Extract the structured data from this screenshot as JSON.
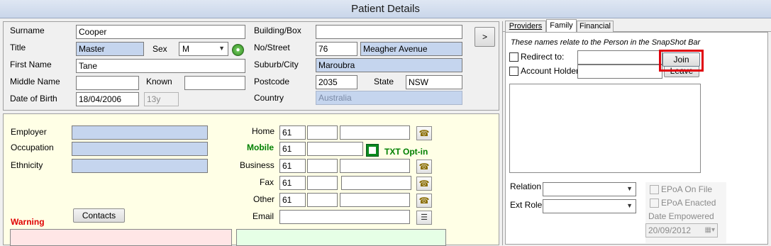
{
  "window": {
    "title": "Patient Details"
  },
  "top": {
    "surname": {
      "label": "Surname",
      "value": "Cooper"
    },
    "title": {
      "label": "Title",
      "value": "Master"
    },
    "sex": {
      "label": "Sex",
      "value": "M"
    },
    "first_name": {
      "label": "First Name",
      "value": "Tane"
    },
    "middle_name": {
      "label": "Middle Name",
      "value": ""
    },
    "known": {
      "label": "Known",
      "value": ""
    },
    "dob": {
      "label": "Date of Birth",
      "value": "18/04/2006",
      "age": "13y"
    },
    "building": {
      "label": "Building/Box",
      "value": ""
    },
    "street": {
      "label": "No/Street",
      "number": "76",
      "name": "Meagher Avenue"
    },
    "suburb": {
      "label": "Suburb/City",
      "value": "Maroubra"
    },
    "postcode": {
      "label": "Postcode",
      "value": "2035"
    },
    "state": {
      "label": "State",
      "value": "NSW"
    },
    "country": {
      "label": "Country",
      "value": "Australia"
    },
    "more_button": ">"
  },
  "lower": {
    "employer": {
      "label": "Employer",
      "value": ""
    },
    "occupation": {
      "label": "Occupation",
      "value": ""
    },
    "ethnicity": {
      "label": "Ethnicity",
      "value": ""
    },
    "warning": "Warning",
    "contacts_button": "Contacts",
    "phones": {
      "home": {
        "label": "Home",
        "code": "61"
      },
      "mobile": {
        "label": "Mobile",
        "code": "61"
      },
      "business": {
        "label": "Business",
        "code": "61"
      },
      "fax": {
        "label": "Fax",
        "code": "61"
      },
      "other": {
        "label": "Other",
        "code": "61"
      }
    },
    "txt_optin": "TXT Opt-in",
    "email": {
      "label": "Email",
      "value": ""
    }
  },
  "right": {
    "tabs": [
      "Providers",
      "Family",
      "Financial"
    ],
    "info": "These names relate to the Person in the SnapShot Bar",
    "redirect": {
      "label": "Redirect to:",
      "value": ""
    },
    "account_holder": {
      "label": "Account Holder",
      "value": ""
    },
    "join_button": "Join",
    "leave_button": "Leave",
    "relation": {
      "label": "Relation"
    },
    "ext_role": {
      "label": "Ext Role"
    },
    "epoa_on_file": "EPoA On File",
    "epoa_enacted": "EPoA Enacted",
    "date_empowered": {
      "label": "Date Empowered",
      "value": "20/09/2012"
    }
  },
  "colors": {
    "highlight": "#e0000b",
    "mobile_green": "#008000",
    "warning_red": "#e00000",
    "lower_bg": "#ffffe6"
  }
}
